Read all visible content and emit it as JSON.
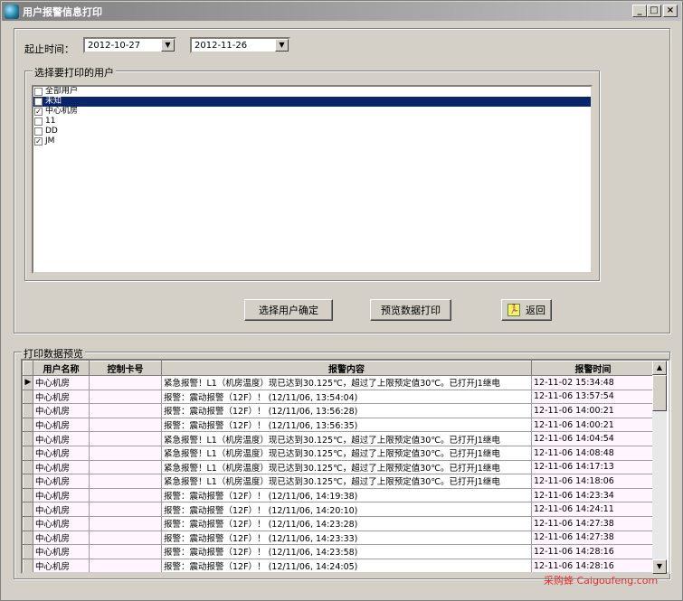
{
  "window": {
    "title": "用户报警信息打印",
    "min_glyph": "_",
    "max_glyph": "□",
    "close_glyph": "×"
  },
  "date_range": {
    "label": "起止时间：",
    "start": "2012-10-27",
    "end": "2012-11-26"
  },
  "user_select": {
    "group_title": "选择要打印的用户",
    "items": [
      {
        "label": "全部用户",
        "checked": false,
        "selected": false
      },
      {
        "label": "未知",
        "checked": false,
        "selected": true
      },
      {
        "label": "中心机房",
        "checked": true,
        "selected": false
      },
      {
        "label": "11",
        "checked": false,
        "selected": false
      },
      {
        "label": "DD",
        "checked": false,
        "selected": false
      },
      {
        "label": "JM",
        "checked": true,
        "selected": false
      }
    ]
  },
  "buttons": {
    "confirm_user": "选择用户确定",
    "preview_print": "预览数据打印",
    "back": "返回"
  },
  "preview": {
    "group_title": "打印数据预览",
    "columns": [
      "用户名称",
      "控制卡号",
      "报警内容",
      "报警时间"
    ],
    "rows": [
      {
        "user": "中心机房",
        "card": "",
        "content": "紧急报警！L1（机房温度）现已达到30.125℃，超过了上限预定值30℃。已打开J1继电",
        "time": "12-11-02 15:34:48",
        "current": true
      },
      {
        "user": "中心机房",
        "card": "",
        "content": "报警：震动报警（12F）！    (12/11/06, 13:54:04)",
        "time": "12-11-06 13:57:54"
      },
      {
        "user": "中心机房",
        "card": "",
        "content": "报警：震动报警（12F）！    (12/11/06, 13:56:28)",
        "time": "12-11-06 14:00:21"
      },
      {
        "user": "中心机房",
        "card": "",
        "content": "报警：震动报警（12F）！    (12/11/06, 13:56:35)",
        "time": "12-11-06 14:00:21"
      },
      {
        "user": "中心机房",
        "card": "",
        "content": "紧急报警！L1（机房温度）现已达到30.125℃，超过了上限预定值30℃。已打开J1继电",
        "time": "12-11-06 14:04:54"
      },
      {
        "user": "中心机房",
        "card": "",
        "content": "紧急报警！L1（机房温度）现已达到30.125℃，超过了上限预定值30℃。已打开J1继电",
        "time": "12-11-06 14:08:48"
      },
      {
        "user": "中心机房",
        "card": "",
        "content": "紧急报警！L1（机房温度）现已达到30.125℃，超过了上限预定值30℃。已打开J1继电",
        "time": "12-11-06 14:17:13"
      },
      {
        "user": "中心机房",
        "card": "",
        "content": "紧急报警！L1（机房温度）现已达到30.125℃，超过了上限预定值30℃。已打开J1继电",
        "time": "12-11-06 14:18:06"
      },
      {
        "user": "中心机房",
        "card": "",
        "content": "报警：震动报警（12F）！    (12/11/06, 14:19:38)",
        "time": "12-11-06 14:23:34"
      },
      {
        "user": "中心机房",
        "card": "",
        "content": "报警：震动报警（12F）！    (12/11/06, 14:20:10)",
        "time": "12-11-06 14:24:11"
      },
      {
        "user": "中心机房",
        "card": "",
        "content": "报警：震动报警（12F）！    (12/11/06, 14:23:28)",
        "time": "12-11-06 14:27:38"
      },
      {
        "user": "中心机房",
        "card": "",
        "content": "报警：震动报警（12F）！    (12/11/06, 14:23:33)",
        "time": "12-11-06 14:27:38"
      },
      {
        "user": "中心机房",
        "card": "",
        "content": "报警：震动报警（12F）！    (12/11/06, 14:23:58)",
        "time": "12-11-06 14:28:16"
      },
      {
        "user": "中心机房",
        "card": "",
        "content": "报警：震动报警（12F）！    (12/11/06, 14:24:05)",
        "time": "12-11-06 14:28:16"
      }
    ]
  },
  "watermark": "采购蜂 Caigoufeng.com"
}
